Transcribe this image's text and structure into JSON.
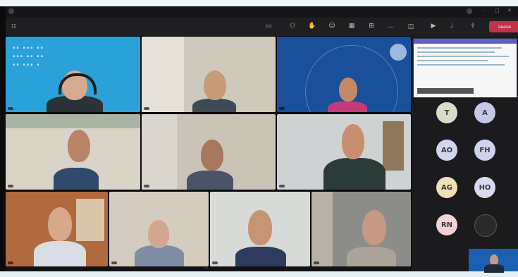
{
  "window": {
    "title": "",
    "account": ""
  },
  "toolbar": {
    "time": "",
    "buttons": [
      {
        "label": "",
        "icon": "chat-icon"
      },
      {
        "label": "",
        "icon": "people-icon"
      },
      {
        "label": "",
        "icon": "raise-hand-icon"
      },
      {
        "label": "",
        "icon": "react-icon"
      },
      {
        "label": "",
        "icon": "view-icon"
      },
      {
        "label": "",
        "icon": "apps-icon"
      },
      {
        "label": "",
        "icon": "more-icon"
      },
      {
        "label": "",
        "icon": "camera-icon"
      },
      {
        "label": "",
        "icon": "mic-icon"
      },
      {
        "label": "",
        "icon": "share-icon"
      }
    ],
    "leave_label": "Leave"
  },
  "participants": [
    {
      "name": "",
      "bg": "#2aa1d8"
    },
    {
      "name": "",
      "bg": "#cfc9bd"
    },
    {
      "name": "",
      "bg": "#1a4f9a"
    },
    {
      "name": "",
      "bg": "#d9d3c8"
    },
    {
      "name": "",
      "bg": "#cac4b8"
    },
    {
      "name": "",
      "bg": "#cfd2d3"
    },
    {
      "name": "",
      "bg": "#b06a3d"
    },
    {
      "name": "",
      "bg": "#d4ccbe"
    },
    {
      "name": "",
      "bg": "#d8dad8"
    },
    {
      "name": "",
      "bg": "#8c8c88"
    }
  ],
  "roster": [
    {
      "initials": "T",
      "name": "",
      "color": "#d9dcc8"
    },
    {
      "initials": "A",
      "name": "",
      "color": "#c3c8e6"
    },
    {
      "initials": "AO",
      "name": "",
      "color": "#d3d5ee"
    },
    {
      "initials": "FH",
      "name": "",
      "color": "#cdd2ee"
    },
    {
      "initials": "AG",
      "name": "",
      "color": "#efe0b6"
    },
    {
      "initials": "HO",
      "name": "",
      "color": "#d7daf0"
    },
    {
      "initials": "RN",
      "name": "",
      "color": "#f2d2d5"
    },
    {
      "initials": "",
      "name": "",
      "color": "#2a2a2c"
    }
  ],
  "colors": {
    "accent": "#5b5fc7",
    "leave": "#c4314b"
  }
}
